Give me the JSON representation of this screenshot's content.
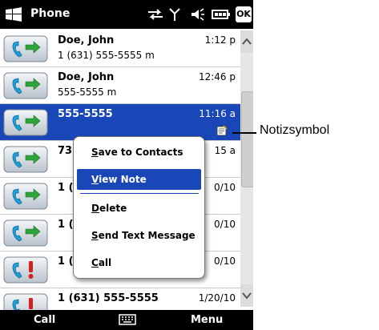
{
  "titlebar": {
    "app_title": "Phone",
    "ok_label": "OK",
    "icons": [
      "windows-start-icon",
      "sync-icon",
      "signal-icon",
      "volume-icon",
      "battery-icon"
    ]
  },
  "call_log": [
    {
      "name": "Doe, John",
      "detail": "1 (631) 555-5555 m",
      "time": "1:12 p",
      "type": "outgoing",
      "selected": false
    },
    {
      "name": "Doe, John",
      "detail": "555-5555 m",
      "time": "12:46 p",
      "type": "outgoing",
      "selected": false
    },
    {
      "name": "555-5555",
      "detail": "",
      "time": "11:16 a",
      "type": "outgoing",
      "selected": true,
      "has_note": true
    },
    {
      "name": "73",
      "detail": "",
      "time": "15 a",
      "type": "outgoing",
      "selected": false
    },
    {
      "name": "1 (",
      "detail": "",
      "time": "0/10",
      "type": "outgoing",
      "selected": false
    },
    {
      "name": "1 (",
      "detail": "",
      "time": "0/10",
      "type": "outgoing",
      "selected": false
    },
    {
      "name": "1 (",
      "detail": "",
      "time": "0/10",
      "type": "missed",
      "selected": false
    },
    {
      "name": "1 (631) 555-5555",
      "detail": "",
      "time": "1/20/10",
      "type": "missed",
      "selected": false
    }
  ],
  "context_menu": {
    "items": [
      {
        "label": "Save to Contacts",
        "active": false
      },
      {
        "label": "View Note",
        "active": true
      },
      {
        "label": "Delete",
        "active": false
      },
      {
        "label": "Send Text Message",
        "active": false
      },
      {
        "label": "Call",
        "active": false
      }
    ]
  },
  "softkeys": {
    "left": "Call",
    "right": "Menu",
    "center_icon": "keyboard-icon"
  },
  "annotation": {
    "label": "Notizsymbol"
  },
  "colors": {
    "selection": "#1a47b8",
    "bar": "#000000",
    "outgoing_icon": "#2fa43a",
    "missed_icon": "#d42020"
  }
}
